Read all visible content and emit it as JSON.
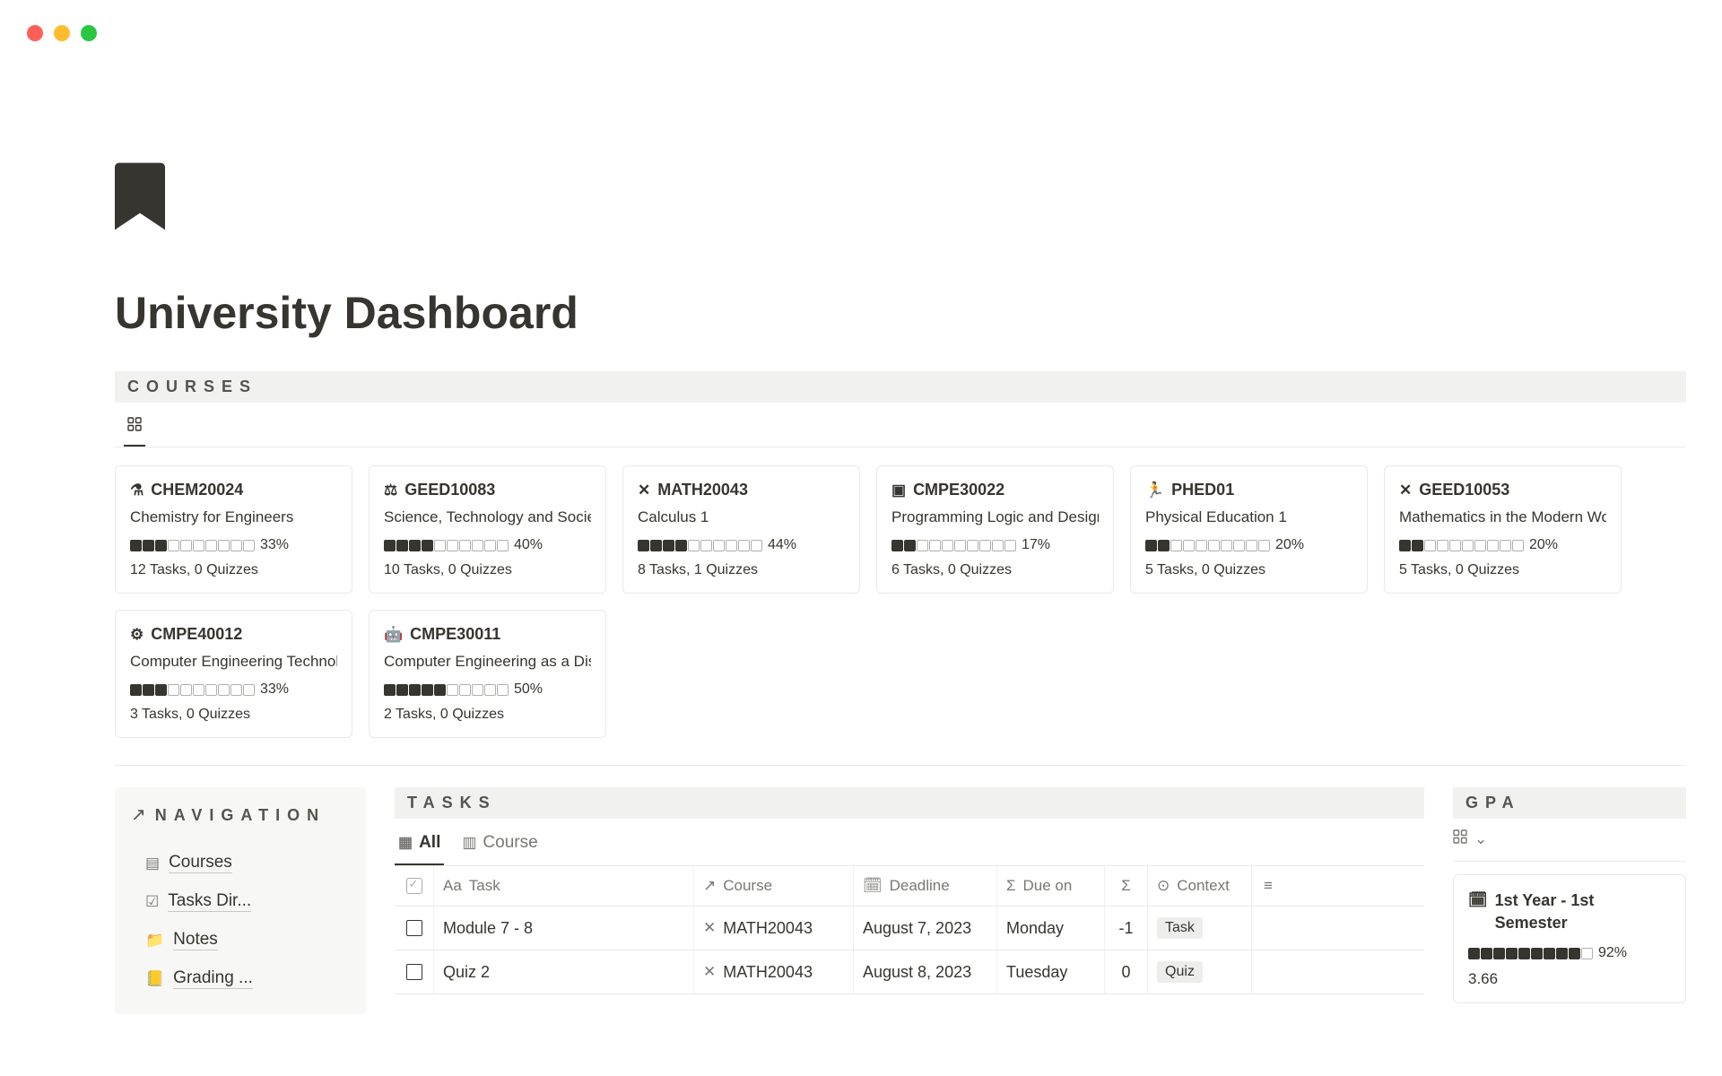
{
  "page": {
    "title": "University Dashboard"
  },
  "sections": {
    "courses": "COURSES",
    "tasks": "TASKS",
    "gpa": "GPA"
  },
  "courses": [
    {
      "code": "CHEM20024",
      "name": "Chemistry for Engineers",
      "pct": "33%",
      "filled": 3,
      "meta": "12 Tasks, 0 Quizzes",
      "icon": "⚗"
    },
    {
      "code": "GEED10083",
      "name": "Science, Technology and Society",
      "pct": "40%",
      "filled": 4,
      "meta": "10 Tasks, 0 Quizzes",
      "icon": "⚖"
    },
    {
      "code": "MATH20043",
      "name": "Calculus 1",
      "pct": "44%",
      "filled": 4,
      "meta": "8 Tasks, 1 Quizzes",
      "icon": "✕"
    },
    {
      "code": "CMPE30022",
      "name": "Programming Logic and Design",
      "pct": "17%",
      "filled": 2,
      "meta": "6 Tasks, 0 Quizzes",
      "icon": "▣"
    },
    {
      "code": "PHED01",
      "name": "Physical Education 1",
      "pct": "20%",
      "filled": 2,
      "meta": "5 Tasks, 0 Quizzes",
      "icon": "🏃"
    },
    {
      "code": "GEED10053",
      "name": "Mathematics in the Modern World",
      "pct": "20%",
      "filled": 2,
      "meta": "5 Tasks, 0 Quizzes",
      "icon": "✕"
    },
    {
      "code": "CMPE40012",
      "name": "Computer Engineering Technology",
      "pct": "33%",
      "filled": 3,
      "meta": "3 Tasks, 0 Quizzes",
      "icon": "⚙"
    },
    {
      "code": "CMPE30011",
      "name": "Computer Engineering as a Discipline",
      "pct": "50%",
      "filled": 5,
      "meta": "2 Tasks, 0 Quizzes",
      "icon": "🤖"
    }
  ],
  "nav": {
    "title": "NAVIGATION",
    "items": [
      {
        "label": "Courses",
        "icon": "▤"
      },
      {
        "label": "Tasks Dir...",
        "icon": "☑"
      },
      {
        "label": "Notes",
        "icon": "📁"
      },
      {
        "label": "Grading ...",
        "icon": "📒"
      }
    ]
  },
  "tasks": {
    "tabs": {
      "all": "All",
      "course": "Course"
    },
    "headers": {
      "task": "Task",
      "course": "Course",
      "deadline": "Deadline",
      "due": "Due on",
      "context": "Context"
    },
    "rows": [
      {
        "task": "Module 7 - 8",
        "course": "MATH20043",
        "deadline": "August 7, 2023",
        "due": "Monday",
        "sigma": "-1",
        "context": "Task"
      },
      {
        "task": "Quiz 2",
        "course": "MATH20043",
        "deadline": "August 8, 2023",
        "due": "Tuesday",
        "sigma": "0",
        "context": "Quiz"
      }
    ]
  },
  "gpa": {
    "card": {
      "title": "1st Year - 1st Semester",
      "filled": 9,
      "pct": "92%",
      "value": "3.66"
    }
  }
}
